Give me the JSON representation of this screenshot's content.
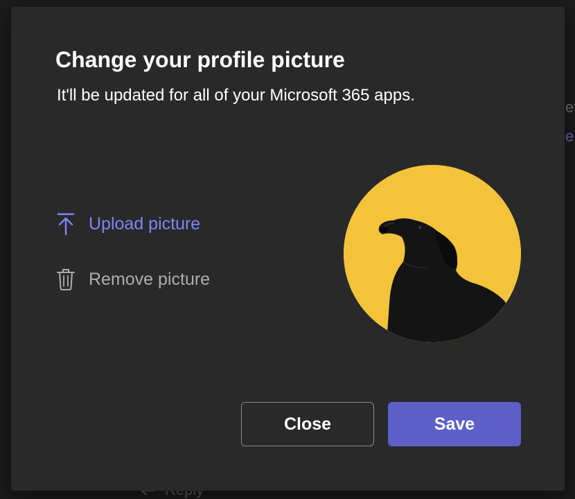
{
  "background": {
    "right_fragment_1": "et",
    "right_fragment_2": "e",
    "reply_label": "Reply"
  },
  "dialog": {
    "title": "Change your profile picture",
    "subtitle": "It'll be updated for all of your Microsoft 365 apps.",
    "actions": {
      "upload_label": "Upload picture",
      "upload_icon": "upload-arrow-icon",
      "remove_label": "Remove picture",
      "remove_icon": "trash-icon"
    },
    "avatar": {
      "description_icon": "profile-photo-black-dog",
      "background_color": "#f3c33c"
    },
    "buttons": {
      "close_label": "Close",
      "save_label": "Save"
    }
  },
  "colors": {
    "accent": "#7f85f5",
    "primary_button": "#5b5fc7",
    "dialog_bg": "#292929"
  }
}
